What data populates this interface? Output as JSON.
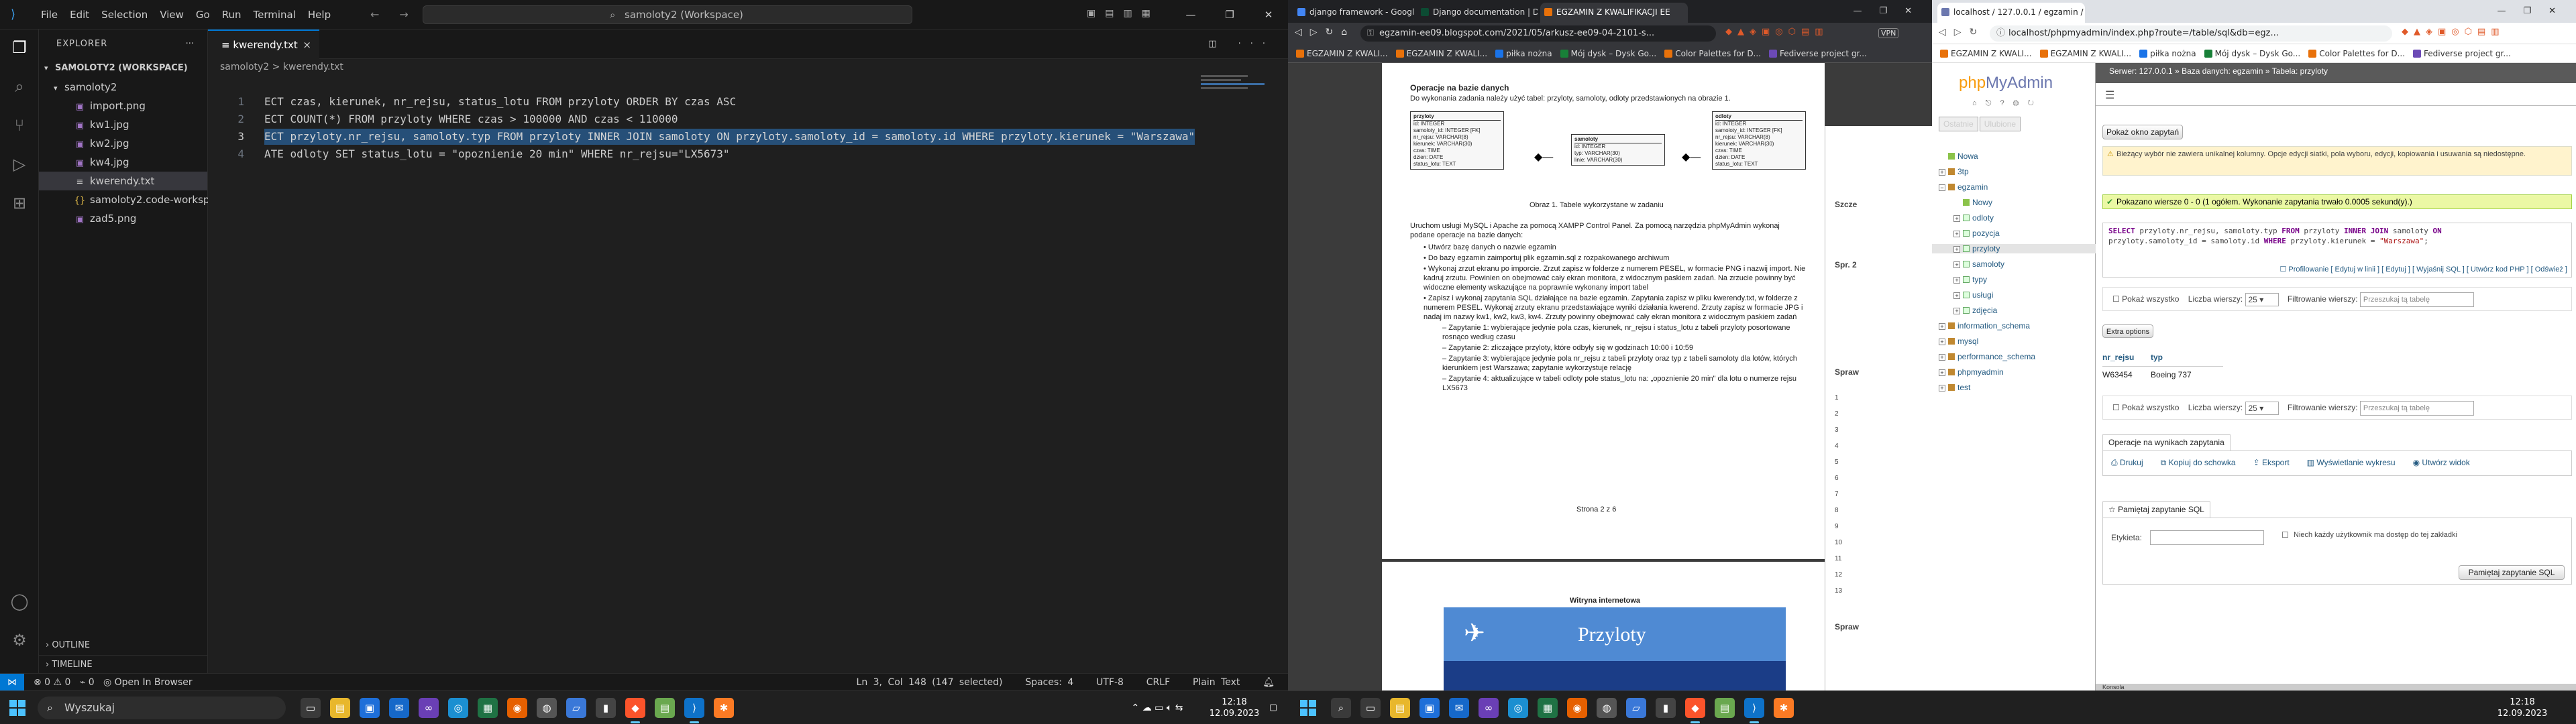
{
  "vscode": {
    "menu": [
      "File",
      "Edit",
      "Selection",
      "View",
      "Go",
      "Run",
      "Terminal",
      "Help"
    ],
    "search_text": "samoloty2 (Workspace)",
    "explorer_title": "EXPLORER",
    "workspace": "SAMOLOTY2 (WORKSPACE)",
    "folder": "samoloty2",
    "files": [
      {
        "name": "import.png",
        "icon": "image-icon",
        "color": "#a074c4"
      },
      {
        "name": "kw1.jpg",
        "icon": "image-icon",
        "color": "#a074c4"
      },
      {
        "name": "kw2.jpg",
        "icon": "image-icon",
        "color": "#a074c4"
      },
      {
        "name": "kw4.jpg",
        "icon": "image-icon",
        "color": "#a074c4"
      },
      {
        "name": "kwerendy.txt",
        "icon": "text-file-icon",
        "color": "#cccccc",
        "selected": true
      },
      {
        "name": "samoloty2.code-workspace",
        "icon": "json-icon",
        "color": "#e8c04a"
      },
      {
        "name": "zad5.png",
        "icon": "image-icon",
        "color": "#a074c4"
      }
    ],
    "outline": "OUTLINE",
    "timeline": "TIMELINE",
    "tab_name": "kwerendy.txt",
    "breadcrumb": "samoloty2 > kwerendy.txt",
    "code_lines": [
      {
        "n": "1",
        "text": "ECT czas, kierunek, nr_rejsu, status_lotu FROM przyloty ORDER BY czas ASC"
      },
      {
        "n": "2",
        "text": "ECT COUNT(*) FROM przyloty WHERE czas > 100000 AND czas < 110000"
      },
      {
        "n": "3",
        "text": "ECT przyloty.nr_rejsu, samoloty.typ FROM przyloty INNER JOIN samoloty ON przyloty.samoloty_id = samoloty.id WHERE przyloty.kierunek = \"Warszawa\""
      },
      {
        "n": "4",
        "text": "ATE odloty SET status_lotu = \"opoznienie 20 min\" WHERE nr_rejsu=\"LX5673\""
      }
    ],
    "status": {
      "problems": "⊗ 0 ⚠ 0",
      "ports": "⌁ 0",
      "open_in_browser": "Open In Browser",
      "position": "Ln 3, Col 148 (147 selected)",
      "spaces": "Spaces: 4",
      "encoding": "UTF-8",
      "eol": "CRLF",
      "language": "Plain Text"
    }
  },
  "browser1": {
    "tabs": [
      {
        "title": "django framework - Google Search",
        "color": "#4285f4"
      },
      {
        "title": "Django documentation | Django do",
        "color": "#0c4b33"
      },
      {
        "title": "EGZAMIN Z KWALIFIKACJI EE",
        "color": "#e8710a",
        "active": true
      }
    ],
    "url": "egzamin-ee09.blogspot.com/2021/05/arkusz-ee09-04-2101-s...",
    "vpn": "VPN",
    "bookmarks": [
      "EGZAMIN Z KWALI...",
      "EGZAMIN Z KWALI...",
      "piłka nożna",
      "Mój dysk – Dysk Go...",
      "Color Palettes for D...",
      "Fediverse project gr..."
    ],
    "doc": {
      "heading": "Operacje na bazie danych",
      "intro": "Do wykonania zadania należy użyć tabel: przyloty, samoloty, odloty przedstawionych na obrazie 1.",
      "caption": "Obraz 1. Tabele wykorzystane w zadaniu",
      "para": "Uruchom usługi MySQL i Apache za pomocą XAMPP Control Panel. Za pomocą narzędzia phpMyAdmin wykonaj podane operacje na bazie danych:",
      "items": [
        {
          "t": "Utwórz bazę danych o nazwie egzamin",
          "sub": false
        },
        {
          "t": "Do bazy egzamin zaimportuj plik egzamin.sql z rozpakowanego archiwum",
          "sub": false
        },
        {
          "t": "Wykonaj zrzut ekranu po imporcie. Zrzut zapisz w folderze z numerem PESEL, w formacie PNG i nazwij import. Nie kadruj zrzutu. Powinien on obejmować cały ekran monitora, z widocznym paskiem zadań. Na zrzucie powinny być widoczne elementy wskazujące na poprawnie wykonany import tabel",
          "sub": false
        },
        {
          "t": "Zapisz i wykonaj zapytania SQL działające na bazie egzamin. Zapytania zapisz w pliku kwerendy.txt, w folderze z numerem PESEL. Wykonaj zrzuty ekranu przedstawiające wyniki działania kwerend. Zrzuty zapisz w formacie JPG i nadaj im nazwy kw1, kw2, kw3, kw4. Zrzuty powinny obejmować cały ekran monitora z widocznym paskiem zadań",
          "sub": false
        },
        {
          "t": "Zapytanie 1: wybierające jedynie pola czas, kierunek, nr_rejsu i status_lotu z tabeli przyloty posortowane rosnąco według czasu",
          "sub": true
        },
        {
          "t": "Zapytanie 2: zliczające przyloty, które odbyły się w godzinach 10:00 i 10:59",
          "sub": true
        },
        {
          "t": "Zapytanie 3: wybierające jedynie pola nr_rejsu z tabeli przyloty oraz typ z tabeli samoloty dla lotów, których kierunkiem jest Warszawa; zapytanie wykorzystuje relację",
          "sub": true
        },
        {
          "t": "Zapytanie 4: aktualizujące w tabeli odloty pole status_lotu na: „opoznienie 20 min\" dla lotu o numerze rejsu LX5673",
          "sub": true
        }
      ],
      "tables": [
        {
          "name": "przyloty",
          "fields": [
            "id: INTEGER",
            "samoloty_id: INTEGER [FK]",
            "nr_rejsu: VARCHAR(8)",
            "kierunek: VARCHAR(30)",
            "czas: TIME",
            "dzien: DATE",
            "status_lotu: TEXT"
          ]
        },
        {
          "name": "samoloty",
          "fields": [
            "id: INTEGER",
            "typ: VARCHAR(30)",
            "linie: VARCHAR(30)"
          ]
        },
        {
          "name": "odloty",
          "fields": [
            "id: INTEGER",
            "samoloty_id: INTEGER [FK]",
            "nr_rejsu: VARCHAR(8)",
            "kierunek: VARCHAR(30)",
            "czas: TIME",
            "dzien: DATE",
            "status_lotu: TEXT"
          ]
        }
      ],
      "page": "Strona 2 z 6",
      "site_heading": "Witryna internetowa",
      "banner_title": "Przyloty"
    },
    "side_labels": [
      "Szcze",
      "Spr. 2",
      "Spraw",
      "Spraw"
    ],
    "side_numbers": [
      "1",
      "2",
      "3",
      "4",
      "5",
      "6",
      "7",
      "8",
      "9",
      "10",
      "11",
      "12",
      "13"
    ]
  },
  "browser2": {
    "tabs": [
      {
        "title": "localhost / 127.0.0.1 / egzamin / p",
        "active": true
      }
    ],
    "url": "localhost/phpmyadmin/index.php?route=/table/sql&db=egz...",
    "bookmarks": [
      "EGZAMIN Z KWALI...",
      "EGZAMIN Z KWALI...",
      "piłka nożna",
      "Mój dysk – Dysk Go...",
      "Color Palettes for D...",
      "Fediverse project gr..."
    ],
    "pma": {
      "logo_a": "php",
      "logo_b": "MyAdmin",
      "ltabs": [
        "Ostatnie",
        "Ulubione"
      ],
      "tree": [
        {
          "label": "Nowa",
          "indent": 0,
          "kind": "new"
        },
        {
          "label": "3tp",
          "indent": 0,
          "kind": "db"
        },
        {
          "label": "egzamin",
          "indent": 0,
          "kind": "db",
          "open": true
        },
        {
          "label": "Nowy",
          "indent": 1,
          "kind": "new"
        },
        {
          "label": "odloty",
          "indent": 1,
          "kind": "tb"
        },
        {
          "label": "pozycja",
          "indent": 1,
          "kind": "tb"
        },
        {
          "label": "przyloty",
          "indent": 1,
          "kind": "tb",
          "sel": true
        },
        {
          "label": "samoloty",
          "indent": 1,
          "kind": "tb"
        },
        {
          "label": "typy",
          "indent": 1,
          "kind": "tb"
        },
        {
          "label": "usługi",
          "indent": 1,
          "kind": "tb"
        },
        {
          "label": "zdjęcia",
          "indent": 1,
          "kind": "tb"
        },
        {
          "label": "information_schema",
          "indent": 0,
          "kind": "db"
        },
        {
          "label": "mysql",
          "indent": 0,
          "kind": "db"
        },
        {
          "label": "performance_schema",
          "indent": 0,
          "kind": "db"
        },
        {
          "label": "phpmyadmin",
          "indent": 0,
          "kind": "db"
        },
        {
          "label": "test",
          "indent": 0,
          "kind": "db"
        }
      ],
      "breadcrumb": "Serwer: 127.0.0.1 » Baza danych: egzamin » Tabela: przyloty",
      "show_query_btn": "Pokaż okno zapytań",
      "notice": "Bieżący wybór nie zawiera unikalnej kolumny. Opcje edycji siatki, pola wyboru, edycji, kopiowania i usuwania są niedostępne.",
      "success": "Pokazano wiersze 0 - 0 (1 ogółem. Wykonanie zapytania trwało 0.0005 sekund(y).)",
      "sql_links": "Profilowanie [ Edytuj w linii ] [ Edytuj ] [ Wyjaśnij SQL ] [ Utwórz kod PHP ] [ Odśwież ]",
      "show_all": "Pokaż wszystko",
      "rows_label": "Liczba wierszy:",
      "rows_value": "25",
      "filter_label": "Filtrowanie wierszy:",
      "filter_placeholder": "Przeszukaj tą tabelę",
      "extra": "Extra options",
      "cols": [
        "nr_rejsu",
        "typ"
      ],
      "row": [
        "W63454",
        "Boeing 737"
      ],
      "ops_title": "Operacje na wynikach zapytania",
      "ops": [
        "Drukuj",
        "Kopiuj do schowka",
        "Eksport",
        "Wyświetlanie wykresu",
        "Utwórz widok"
      ],
      "bookmark_title": "Pamiętaj zapytanie SQL",
      "label_field": "Etykieta:",
      "public_check": "Niech każdy użytkownik ma dostęp do tej zakładki",
      "bookmark_btn": "Pamiętaj zapytanie SQL",
      "console": "Konsola"
    }
  },
  "taskbar": {
    "search": "Wyszukaj",
    "time": "12:18",
    "date": "12.09.2023"
  }
}
